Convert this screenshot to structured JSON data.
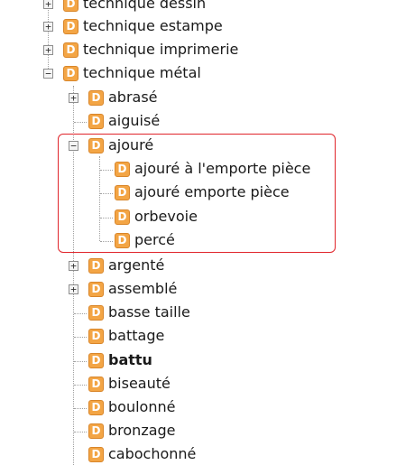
{
  "tree": {
    "node_icon_letter": "D",
    "icon_color": "#f3a545",
    "highlight_color": "#e0252b",
    "items": [
      {
        "label": "technique dessin",
        "state": "collapsed",
        "level": 0
      },
      {
        "label": "technique estampe",
        "state": "collapsed",
        "level": 0
      },
      {
        "label": "technique imprimerie",
        "state": "collapsed",
        "level": 0
      },
      {
        "label": "technique métal",
        "state": "expanded",
        "level": 0
      },
      {
        "label": "abrasé",
        "state": "collapsed",
        "level": 1
      },
      {
        "label": "aiguisé",
        "state": "leaf",
        "level": 1
      },
      {
        "label": "ajouré",
        "state": "expanded",
        "level": 1
      },
      {
        "label": "ajouré à l'emporte pièce",
        "state": "leaf",
        "level": 2
      },
      {
        "label": "ajouré emporte pièce",
        "state": "leaf",
        "level": 2
      },
      {
        "label": "orbevoie",
        "state": "leaf",
        "level": 2
      },
      {
        "label": "percé",
        "state": "leaf",
        "level": 2
      },
      {
        "label": "argenté",
        "state": "collapsed",
        "level": 1
      },
      {
        "label": "assemblé",
        "state": "collapsed",
        "level": 1
      },
      {
        "label": "basse taille",
        "state": "leaf",
        "level": 1
      },
      {
        "label": "battage",
        "state": "leaf",
        "level": 1
      },
      {
        "label": "battu",
        "state": "leaf",
        "level": 1,
        "selected": true
      },
      {
        "label": "biseauté",
        "state": "leaf",
        "level": 1
      },
      {
        "label": "boulonné",
        "state": "leaf",
        "level": 1
      },
      {
        "label": "bronzage",
        "state": "leaf",
        "level": 1
      },
      {
        "label": "cabochonné",
        "state": "leaf",
        "level": 1
      }
    ],
    "expander_collapsed_symbol": "+",
    "expander_expanded_symbol": "−"
  }
}
